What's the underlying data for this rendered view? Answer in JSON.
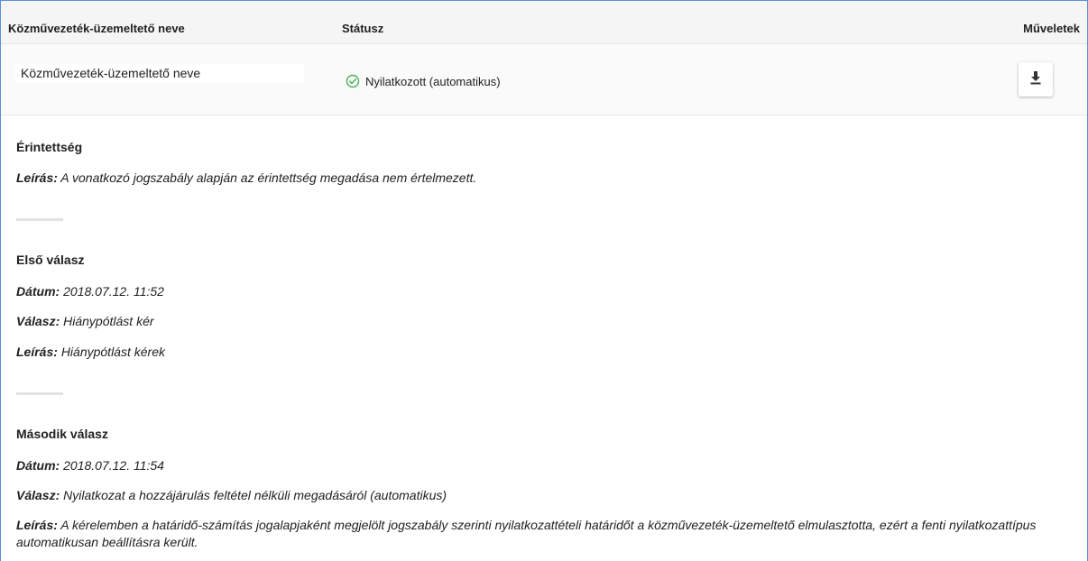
{
  "table": {
    "headers": {
      "name": "Közművezeték-üzemeltető neve",
      "status": "Státusz",
      "operations": "Műveletek"
    },
    "row": {
      "name": "Közművezeték-üzemeltető neve",
      "status": "Nyilatkozott (automatikus)",
      "status_color": "#4caf50",
      "action_icon": "download-icon"
    }
  },
  "details": {
    "erintettseg": {
      "title": "Érintettség",
      "desc_label": "Leírás:",
      "desc_value": "A vonatkozó jogszabály alapján az érintettség megadása nem értelmezett."
    },
    "first_response": {
      "title": "Első válasz",
      "date_label": "Dátum:",
      "date_value": "2018.07.12. 11:52",
      "answer_label": "Válasz:",
      "answer_value": "Hiánypótlást kér",
      "desc_label": "Leírás:",
      "desc_value": "Hiánypótlást kérek"
    },
    "second_response": {
      "title": "Második válasz",
      "date_label": "Dátum:",
      "date_value": "2018.07.12. 11:54",
      "answer_label": "Válasz:",
      "answer_value": "Nyilatkozat a hozzájárulás feltétel nélküli megadásáról (automatikus)",
      "desc_label": "Leírás:",
      "desc_value": "A kérelemben a határidő-számítás jogalapjaként megjelölt jogszabály szerinti nyilatkozattételi határidőt a közművezeték-üzemeltető elmulasztotta, ezért a fenti nyilatkozattípus automatikusan beállításra került."
    }
  }
}
